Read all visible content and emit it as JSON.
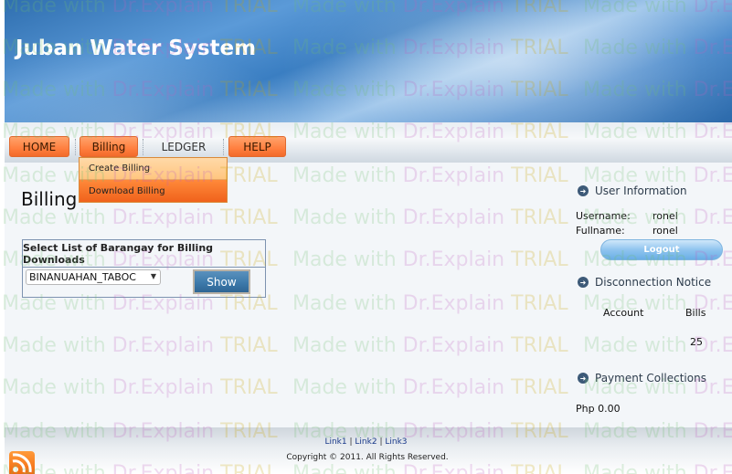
{
  "header": {
    "title": "Juban Water System"
  },
  "nav": {
    "items": [
      "HOME",
      "Billing",
      "LEDGER",
      "HELP"
    ],
    "billing_dropdown": [
      "Create Billing",
      "Download Billing"
    ]
  },
  "main": {
    "heading": "Billing",
    "panel_title": "Select List of Barangay for Billing Downloads",
    "barangay_selected": "BINANUAHAN_TABOC",
    "show_label": "Show"
  },
  "sidebar": {
    "user_info_title": "User Information",
    "username_label": "Username:",
    "username_value": "ronel",
    "fullname_label": "Fullname:",
    "fullname_value": "ronel",
    "logout_label": "Logout",
    "disconnection_title": "Disconnection Notice",
    "col_account": "Account",
    "col_bills": "Bills",
    "bills_count": "25",
    "payment_title": "Payment Collections",
    "payment_amount": "Php 0.00"
  },
  "footer": {
    "links": [
      "Link1",
      "Link2",
      "Link3"
    ],
    "separator": "|",
    "copyright": "Copyright © 2011. All Rights Reserved."
  },
  "watermark": {
    "part1": "Made with ",
    "part2": "Dr.Explain ",
    "part3": "TRIAL"
  },
  "colors": {
    "accent_orange": "#ff7f3f",
    "header_blue": "#3a7ec2",
    "button_blue": "#3d7aab"
  },
  "icons": {
    "section": "circle-arrow-right-icon",
    "rss": "rss-icon",
    "dropdown": "chevron-down-icon"
  }
}
